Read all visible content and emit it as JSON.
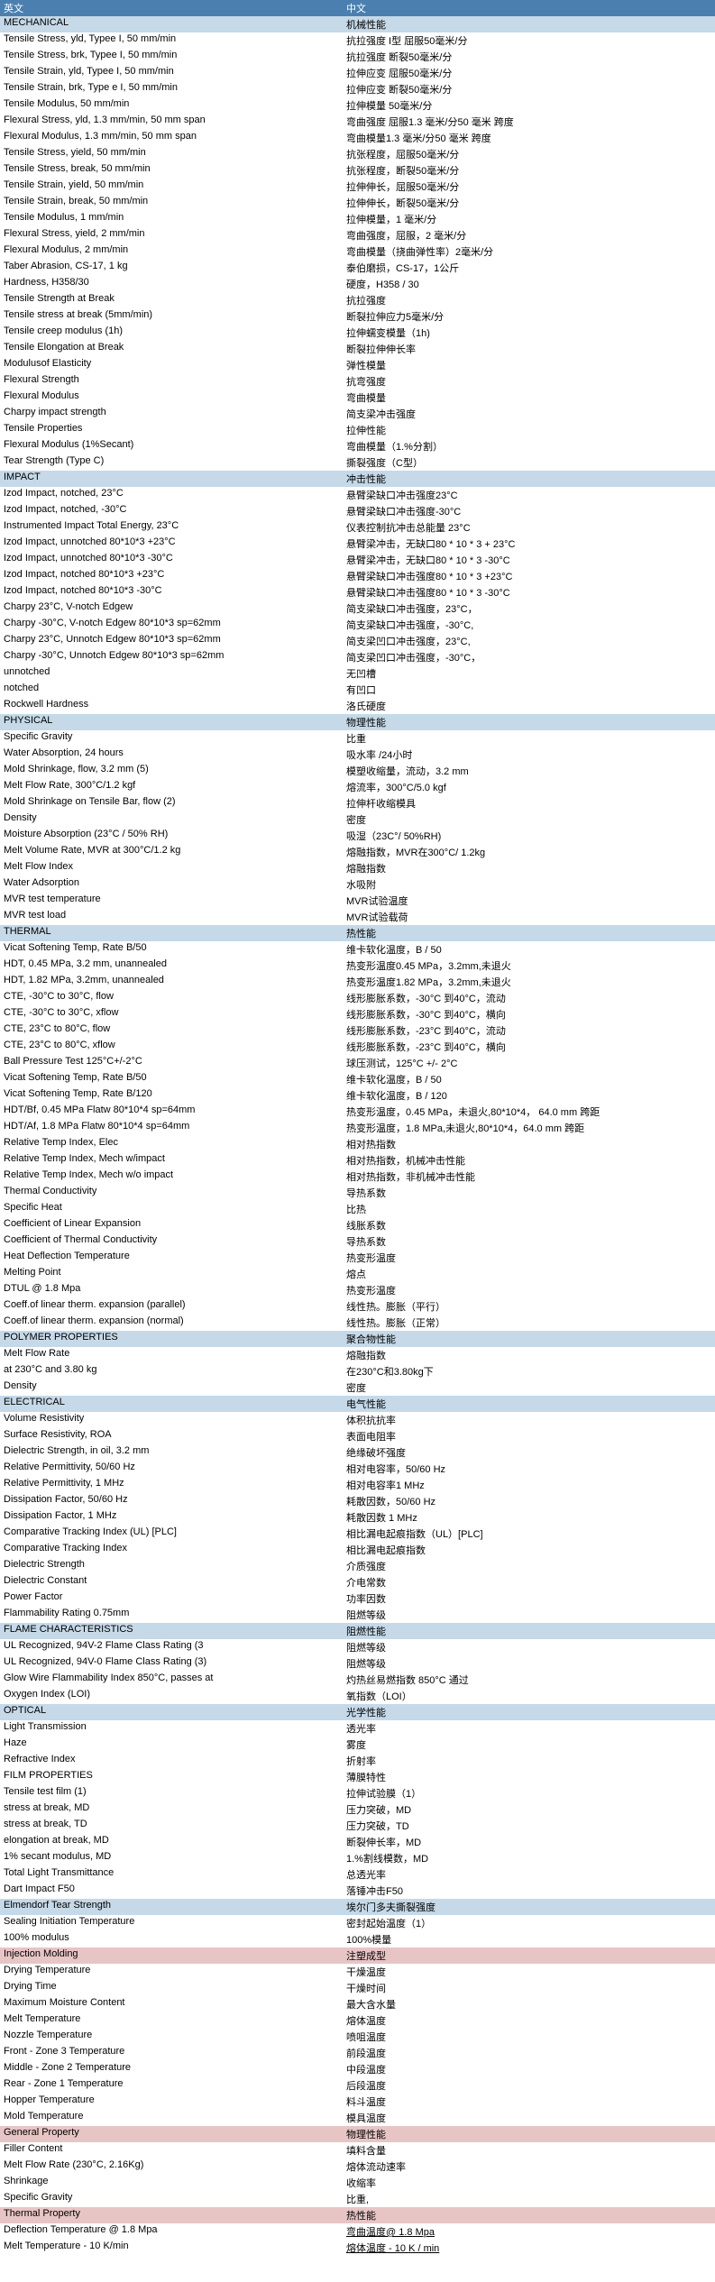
{
  "header": {
    "en": "英文",
    "cn": "中文"
  },
  "groups": [
    {
      "section": {
        "en": "MECHANICAL",
        "cn": "机械性能"
      },
      "rows": [
        {
          "en": "Tensile Stress, yld, Typee I, 50 mm/min",
          "cn": "抗拉强度 I型 屈服50毫米/分"
        },
        {
          "en": "Tensile Stress, brk, Typee I, 50 mm/min",
          "cn": "抗拉强度 断裂50毫米/分"
        },
        {
          "en": "Tensile Strain, yld, Typee I, 50 mm/min",
          "cn": "拉伸应变 屈服50毫米/分"
        },
        {
          "en": "Tensile Strain, brk, Type e I, 50 mm/min",
          "cn": "拉伸应变 断裂50毫米/分"
        },
        {
          "en": "Tensile Modulus, 50 mm/min",
          "cn": "拉伸模量 50毫米/分"
        },
        {
          "en": "Flexural Stress, yld, 1.3 mm/min, 50 mm span",
          "cn": "弯曲强度 屈服1.3 毫米/分50 毫米 跨度"
        },
        {
          "en": "Flexural Modulus, 1.3 mm/min, 50 mm span",
          "cn": "弯曲模量1.3 毫米/分50 毫米 跨度"
        },
        {
          "en": "Tensile Stress, yield, 50 mm/min",
          "cn": "  抗张程度，屈服50毫米/分"
        },
        {
          "en": "Tensile Stress, break, 50 mm/min",
          "cn": "抗张程度，断裂50毫米/分"
        },
        {
          "en": "Tensile Strain, yield, 50 mm/min",
          "cn": "拉伸伸长，屈服50毫米/分"
        },
        {
          "en": "Tensile Strain, break, 50 mm/min",
          "cn": "拉伸伸长，断裂50毫米/分"
        },
        {
          "en": "Tensile Modulus, 1 mm/min",
          "cn": "  拉伸模量，1 毫米/分"
        },
        {
          "en": "Flexural Stress, yield, 2 mm/min",
          "cn": "弯曲强度，屈服，2 毫米/分"
        },
        {
          "en": " Flexural Modulus, 2 mm/min",
          "cn": "弯曲模量（挠曲弹性率）2毫米/分"
        },
        {
          "en": "Taber Abrasion, CS-17, 1 kg",
          "cn": "泰伯磨损，CS-17，1公斤"
        },
        {
          "en": "Hardness, H358/30",
          "cn": "硬度，H358 / 30"
        },
        {
          "en": "Tensile Strength at Break",
          "cn": "抗拉强度"
        },
        {
          "en": "Tensile stress at break (5mm/min)",
          "cn": "断裂拉伸应力5毫米/分"
        },
        {
          "en": "Tensile creep modulus (1h)",
          "cn": "拉伸蠕变模量（1h)"
        },
        {
          "en": "Tensile Elongation at Break",
          "cn": "断裂拉伸伸长率"
        },
        {
          "en": "Modulusof Elasticity",
          "cn": "弹性模量"
        },
        {
          "en": "Flexural Strength",
          "cn": "抗弯强度"
        },
        {
          "en": "Flexural Modulus",
          "cn": "弯曲模量"
        },
        {
          "en": "Charpy impact strength",
          "cn": "简支梁冲击强度"
        },
        {
          "en": "Tensile Properties",
          "cn": "拉伸性能"
        },
        {
          "en": "Flexural Modulus (1%Secant)",
          "cn": "弯曲模量（1.%分割）"
        },
        {
          "en": "Tear Strength (Type C)",
          "cn": "撕裂强度（C型）"
        }
      ]
    },
    {
      "section": {
        "en": "IMPACT",
        "cn": "冲击性能"
      },
      "rows": [
        {
          "en": "Izod Impact, notched, 23°C",
          "cn": "悬臂梁缺口冲击强度23°C"
        },
        {
          "en": "Izod Impact, notched, -30°C",
          "cn": "悬臂梁缺口冲击强度-30°C"
        },
        {
          "en": "Instrumented Impact Total Energy, 23°C",
          "cn": "仪表控制抗冲击总能量 23°C"
        },
        {
          "en": "Izod Impact, unnotched 80*10*3 +23°C",
          "cn": "悬臂梁冲击，无缺口80 * 10 * 3 + 23°C"
        },
        {
          "en": "Izod Impact, unnotched 80*10*3 -30°C",
          "cn": "悬臂梁冲击，无缺口80 * 10 * 3 -30°C"
        },
        {
          "en": "Izod Impact, notched 80*10*3 +23°C",
          "cn": "悬臂梁缺口冲击强度80 * 10 * 3 +23°C"
        },
        {
          "en": "Izod Impact, notched 80*10*3 -30°C",
          "cn": "悬臂梁缺口冲击强度80 * 10 * 3 -30°C"
        },
        {
          "en": "Charpy 23°C, V-notch Edgew",
          "cn": "简支梁缺口冲击强度，23°C，"
        },
        {
          "en": "Charpy -30°C, V-notch Edgew 80*10*3 sp=62mm",
          "cn": "简支梁缺口冲击强度，-30°C,"
        },
        {
          "en": "Charpy  23°C, Unnotch Edgew 80*10*3 sp=62mm",
          "cn": "简支梁凹口冲击强度，23°C,"
        },
        {
          "en": "Charpy -30°C, Unnotch Edgew 80*10*3 sp=62mm",
          "cn": "简支梁凹口冲击强度，-30°C，"
        },
        {
          "en": "unnotched",
          "cn": "无凹槽"
        },
        {
          "en": "notched",
          "cn": "有凹口"
        },
        {
          "en": "Rockwell Hardness",
          "cn": "洛氏硬度"
        }
      ]
    },
    {
      "section": {
        "en": "PHYSICAL",
        "cn": "物理性能"
      },
      "rows": [
        {
          "en": "Specific Gravity",
          "cn": "比重"
        },
        {
          "en": "Water Absorption, 24 hours",
          "cn": "吸水率 /24小时"
        },
        {
          "en": "Mold Shrinkage, flow, 3.2 mm (5)",
          "cn": "模塑收缩量，流动，3.2 mm"
        },
        {
          "en": "Melt Flow Rate, 300°C/1.2 kgf",
          "cn": "熔流率，300°C/5.0 kgf"
        },
        {
          "en": "Mold Shrinkage on Tensile Bar, flow (2)",
          "cn": "拉伸杆收缩模具"
        },
        {
          "en": "Density",
          "cn": "密度"
        },
        {
          "en": "Moisture Absorption (23°C / 50% RH)",
          "cn": "吸湿（23C°/ 50%RH)"
        },
        {
          "en": "Melt Volume Rate, MVR at 300°C/1.2 kg",
          "cn": "熔融指数，MVR在300°C/ 1.2kg"
        },
        {
          "en": "Melt Flow Index",
          "cn": "熔融指数"
        },
        {
          "en": "Water Adsorption",
          "cn": "水吸附"
        },
        {
          "en": "MVR test temperature",
          "cn": "MVR试验温度"
        },
        {
          "en": "MVR test load",
          "cn": "MVR试验载荷"
        }
      ]
    },
    {
      "section": {
        "en": "THERMAL",
        "cn": "热性能"
      },
      "rows": [
        {
          "en": "Vicat Softening Temp, Rate B/50",
          "cn": "维卡软化温度，B / 50"
        },
        {
          "en": "HDT, 0.45 MPa, 3.2 mm, unannealed",
          "cn": "热变形温度0.45 MPa，3.2mm,未退火"
        },
        {
          "en": "HDT, 1.82 MPa, 3.2mm, unannealed",
          "cn": "热变形温度1.82 MPa，3.2mm,未退火"
        },
        {
          "en": "CTE, -30°C to 30°C, flow",
          "cn": "线形膨胀系数，-30°C 到40°C，流动"
        },
        {
          "en": "CTE, -30°C to 30°C, xflow",
          "cn": "线形膨胀系数，-30°C 到40°C，横向"
        },
        {
          "en": "CTE, 23°C to 80°C, flow",
          "cn": "线形膨胀系数，-23°C 到40°C，流动"
        },
        {
          "en": "CTE, 23°C to 80°C, xflow",
          "cn": "线形膨胀系数，-23°C 到40°C，横向"
        },
        {
          "en": "Ball Pressure Test 125°C+/-2°C",
          "cn": "  球压测试，125°C +/- 2°C"
        },
        {
          "en": "Vicat Softening Temp, Rate B/50",
          "cn": "维卡软化温度，B / 50"
        },
        {
          "en": "Vicat Softening Temp, Rate B/120",
          "cn": "维卡软化温度，B / 120"
        },
        {
          "en": "HDT/Bf, 0.45 MPa Flatw 80*10*4 sp=64mm",
          "cn": "热变形温度，0.45 MPa，未退火,80*10*4，  64.0 mm 跨距"
        },
        {
          "en": "HDT/Af, 1.8 MPa Flatw 80*10*4 sp=64mm",
          "cn": "热变形温度，1.8 MPa,未退火,80*10*4，64.0 mm 跨距"
        },
        {
          "en": "Relative Temp Index, Elec",
          "cn": "相对热指数"
        },
        {
          "en": "Relative Temp Index, Mech w/impact",
          "cn": "相对热指数，机械冲击性能"
        },
        {
          "en": "Relative Temp Index, Mech w/o impact",
          "cn": "相对热指数，非机械冲击性能"
        },
        {
          "en": "Thermal Conductivity",
          "cn": "导热系数"
        },
        {
          "en": "Specific Heat",
          "cn": "比热"
        },
        {
          "en": "Coefficient of Linear Expansion",
          "cn": "线胀系数"
        },
        {
          "en": "Coefficient of Thermal Conductivity",
          "cn": "导热系数"
        },
        {
          "en": "Heat Deflection Temperature",
          "cn": "热变形温度"
        },
        {
          "en": "Melting Point",
          "cn": "熔点"
        },
        {
          "en": "DTUL @ 1.8 Mpa",
          "cn": "热变形温度"
        },
        {
          "en": "Coeff.of linear therm. expansion (parallel)",
          "cn": "线性热。膨胀（平行）"
        },
        {
          "en": "Coeff.of linear therm. expansion (normal)",
          "cn": "线性热。膨胀（正常）"
        }
      ]
    },
    {
      "section": {
        "en": "POLYMER PROPERTIES",
        "cn": "聚合物性能"
      },
      "rows": [
        {
          "en": "Melt Flow Rate",
          "cn": "熔融指数"
        },
        {
          "en": "at 230°C and 3.80 kg",
          "cn": "在230°C和3.80kg下"
        },
        {
          "en": "Density",
          "cn": "密度"
        }
      ]
    },
    {
      "section": {
        "en": "ELECTRICAL",
        "cn": "电气性能"
      },
      "rows": [
        {
          "en": "Volume Resistivity",
          "cn": "体积抗抗率"
        },
        {
          "en": "Surface Resistivity, ROA",
          "cn": "表面电阻率"
        },
        {
          "en": "Dielectric Strength, in oil, 3.2 mm",
          "cn": "绝缘破坏强度"
        },
        {
          "en": "Relative Permittivity, 50/60 Hz",
          "cn": "相对电容率，50/60 Hz"
        },
        {
          "en": "Relative Permittivity, 1 MHz",
          "cn": "相对电容率1 MHz"
        },
        {
          "en": "Dissipation Factor, 50/60 Hz",
          "cn": "耗散因数，50/60 Hz"
        },
        {
          "en": "Dissipation Factor, 1 MHz",
          "cn": "耗散因数 1 MHz"
        },
        {
          "en": "Comparative Tracking Index (UL) [PLC]",
          "cn": "相比漏电起痕指数（UL）[PLC]"
        },
        {
          "en": "Comparative Tracking Index",
          "cn": "相比漏电起痕指数"
        },
        {
          "en": "Dielectric Strength",
          "cn": "介质强度"
        },
        {
          "en": "Dielectric Constant",
          "cn": "介电常数"
        },
        {
          "en": "Power Factor",
          "cn": "功率因数"
        },
        {
          "en": "Flammability Rating 0.75mm",
          "cn": "阻燃等级"
        }
      ]
    },
    {
      "section": {
        "en": "FLAME CHARACTERISTICS",
        "cn": "阻燃性能"
      },
      "rows": [
        {
          "en": "UL Recognized, 94V-2  Flame Class Rating (3",
          "cn": "阻燃等级"
        },
        {
          "en": "UL Recognized, 94V-0  Flame Class Rating (3)",
          "cn": "阻燃等级"
        },
        {
          "en": "Glow Wire Flammability Index 850°C, passes at",
          "cn": "灼热丝易燃指数 850°C 通过"
        },
        {
          "en": "Oxygen Index (LOI)",
          "cn": "氧指数（LOI）"
        }
      ]
    },
    {
      "section": {
        "en": "OPTICAL",
        "cn": "光学性能"
      },
      "rows": [
        {
          "en": "Light Transmission",
          "cn": "透光率"
        },
        {
          "en": "Haze",
          "cn": "雾度"
        },
        {
          "en": "Refractive Index",
          "cn": "折射率"
        },
        {
          "en": "FILM PROPERTIES",
          "cn": "薄膜特性"
        },
        {
          "en": "Tensile test film (1)",
          "cn": "拉伸试验膜（1）"
        },
        {
          "en": "stress at break, MD",
          "cn": "压力突破，MD"
        },
        {
          "en": "stress at break, TD",
          "cn": "压力突破，TD"
        },
        {
          "en": "elongation at break, MD",
          "cn": "断裂伸长率，MD"
        },
        {
          "en": "1% secant modulus, MD",
          "cn": "1.%割线模数，MD"
        },
        {
          "en": "Total Light Transmittance",
          "cn": "总透光率"
        },
        {
          "en": "Dart Impact F50",
          "cn": "落锤冲击F50"
        }
      ]
    },
    {
      "section": {
        "en": "Elmendorf Tear Strength",
        "cn": "埃尔门多夫撕裂强度"
      },
      "rows": [
        {
          "en": "Sealing Initiation Temperature",
          "cn": "密封起始温度（1）"
        },
        {
          "en": "100% modulus",
          "cn": "100%模量"
        }
      ]
    },
    {
      "section": {
        "en": "Injection Molding",
        "cn": "注塑成型",
        "pink": true
      },
      "rows": [
        {
          "en": "Drying Temperature",
          "cn": "干燥温度"
        },
        {
          "en": "Drying Time",
          "cn": "干燥时间"
        },
        {
          "en": "Maximum Moisture Content",
          "cn": "最大含水量"
        },
        {
          "en": "Melt Temperature",
          "cn": "熔体温度"
        },
        {
          "en": "Nozzle Temperature",
          "cn": "喷咀温度"
        },
        {
          "en": "Front - Zone 3 Temperature",
          "cn": "前段温度"
        },
        {
          "en": "Middle - Zone 2 Temperature",
          "cn": "中段温度"
        },
        {
          "en": "Rear - Zone 1 Temperature",
          "cn": "后段温度"
        },
        {
          "en": "Hopper Temperature",
          "cn": "料斗温度"
        },
        {
          "en": "Mold Temperature",
          "cn": "模具温度"
        }
      ]
    },
    {
      "section": {
        "en": "General Property",
        "cn": "物理性能",
        "pink": true
      },
      "rows": [
        {
          "en": "Filler Content",
          "cn": "填料含量"
        },
        {
          "en": "Melt Flow Rate (230°C, 2.16Kg)",
          "cn": "熔体流动速率"
        },
        {
          "en": "Shrinkage",
          "cn": "收缩率"
        },
        {
          "en": "Specific Gravity",
          "cn": "比重,\n"
        }
      ]
    },
    {
      "section": {
        "en": "Thermal Property",
        "cn": "热性能",
        "pink": true
      },
      "rows": [
        {
          "en": "Deflection Temperature @ 1.8 Mpa",
          "cn": "弯曲温度@ 1.8 Mpa",
          "link": true
        },
        {
          "en": "Melt Temperature - 10 K/min",
          "cn": "熔体温度 - 10 K / min",
          "link": true
        }
      ]
    }
  ]
}
